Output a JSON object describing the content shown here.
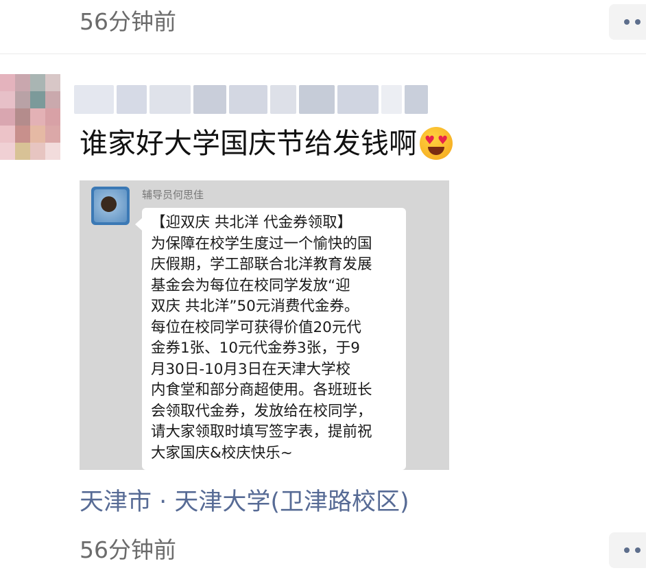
{
  "moments": {
    "top_time": "56分钟前",
    "post": {
      "text": "谁家好大学国庆节给发钱啊",
      "emoji_icon": "smiling-face-with-heart-eyes-drooling",
      "image": {
        "sender_name": "辅导员何思佳",
        "message_lines": [
          "【迎双庆 共北洋 代金券领取】",
          "为保障在校学生度过一个愉快的国",
          "庆假期，学工部联合北洋教育发展",
          "基金会为每位在校同学发放“迎",
          "双庆 共北洋”50元消费代金券。",
          "每位在校同学可获得价值20元代",
          "金券1张、10元代金券3张，于9",
          "月30日-10月3日在天津大学校",
          "内食堂和部分商超使用。各班班长",
          "会领取代金券，发放给在校同学，",
          "请大家领取时填写签字表，提前祝",
          "大家国庆&校庆快乐~"
        ]
      },
      "location": "天津市 · 天津大学(卫津路校区)",
      "time": "56分钟前"
    }
  },
  "colors": {
    "link": "#576b95",
    "time": "#6b6b6b",
    "screenshot_bg": "#d6d6d6"
  }
}
